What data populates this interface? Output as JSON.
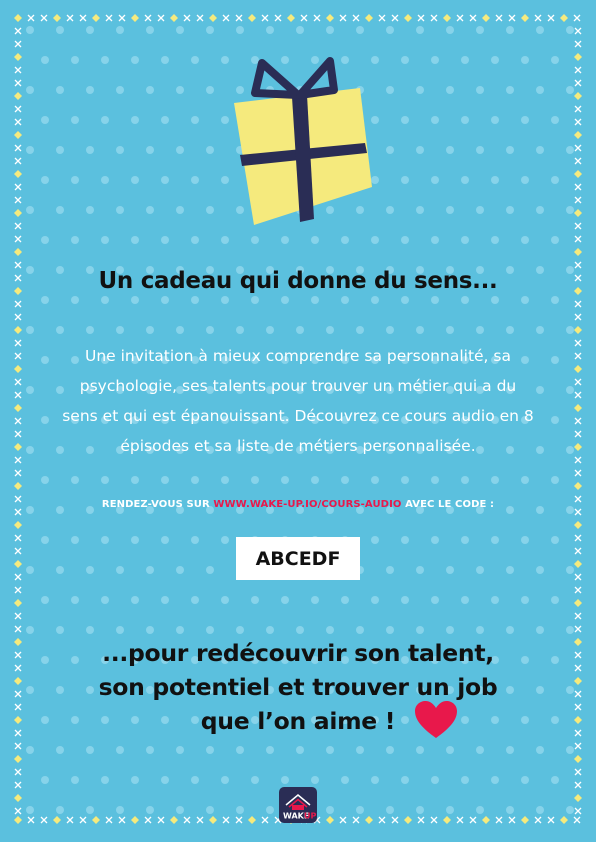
{
  "title": "Un cadeau qui donne du sens...",
  "body": "Une invitation à mieux comprendre sa personnalité, sa psychologie, ses talents pour trouver un métier qui a du sens et qui est épanouissant. Découvrez ce cours audio en 8 épisodes et sa liste de métiers personnalisée.",
  "cta": {
    "prefix": "RENDEZ-VOUS SUR ",
    "link": "WWW.WAKE-UP.IO/COURS-AUDIO",
    "suffix": " AVEC LE CODE :"
  },
  "code": "ABCEDF",
  "closing": {
    "line1": "...pour redécouvrir son talent,",
    "line2": "son potentiel et trouver un job",
    "line3": "que l’on aime !"
  },
  "logo": {
    "text_wake": "WAKE",
    "text_up": "UP"
  },
  "colors": {
    "background": "#5bc0de",
    "dot": "#87d3ea",
    "accent_yellow": "#f5ea7d",
    "navy": "#2a2d55",
    "heart": "#e8184b",
    "link": "#e8184b"
  },
  "icons": [
    "gift-icon",
    "heart-icon",
    "wake-up-logo"
  ]
}
